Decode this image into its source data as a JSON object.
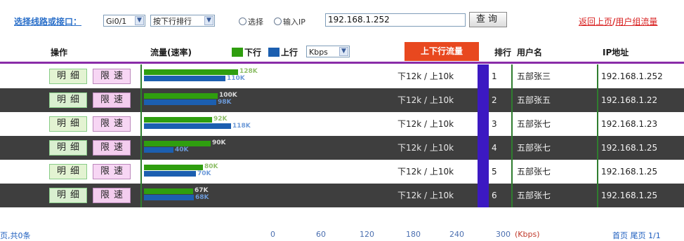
{
  "toolbar": {
    "line_label": "选择线路或接口：",
    "interface_value": "Gi0/1",
    "sort_value": "按下行排行",
    "radio_select_label": "选择",
    "radio_input_label": "输入IP",
    "ip_value": "192.168.1.252",
    "query_label": "查询",
    "back_link": "返回上页",
    "group_link": "用户组流量",
    "link_separator": "/"
  },
  "header": {
    "op_label": "操作",
    "flow_label": "流量(速率)",
    "legend_down_label": "下行",
    "legend_up_label": "上行",
    "unit_value": "Kbps",
    "sort_label": "上下行流量",
    "rank_label": "排行",
    "user_label": "用户名",
    "ip_label": "IP地址"
  },
  "buttons": {
    "detail": "明细",
    "limit": "限速"
  },
  "rows": [
    {
      "up_label": "128K",
      "down_label": "110K",
      "speed": "下12k / 上10k",
      "rank": "1",
      "user": "五部张三",
      "ip": "192.168.1.252"
    },
    {
      "up_label": "100K",
      "down_label": "98K",
      "speed": "下12k / 上10k",
      "rank": "2",
      "user": "五部张五",
      "ip": "192.168.1.22"
    },
    {
      "up_label": "92K",
      "down_label": "118K",
      "speed": "下12k / 上10k",
      "rank": "3",
      "user": "五部张七",
      "ip": "192.168.1.23"
    },
    {
      "up_label": "90K",
      "down_label": "40K",
      "speed": "下12k / 上10k",
      "rank": "4",
      "user": "五部张七",
      "ip": "192.168.1.25"
    },
    {
      "up_label": "80K",
      "down_label": "70K",
      "speed": "下12k / 上10k",
      "rank": "5",
      "user": "五部张七",
      "ip": "192.168.1.25"
    },
    {
      "up_label": "67K",
      "down_label": "68K",
      "speed": "下12k / 上10k",
      "rank": "6",
      "user": "五部张七",
      "ip": "192.168.1.25"
    }
  ],
  "rate_values": [
    {
      "up": 128,
      "down": 110
    },
    {
      "up": 100,
      "down": 98
    },
    {
      "up": 92,
      "down": 118
    },
    {
      "up": 90,
      "down": 40
    },
    {
      "up": 80,
      "down": 70
    },
    {
      "up": 67,
      "down": 68
    }
  ],
  "footer": {
    "count_text": "页,共0条",
    "scale_ticks": [
      "0",
      "60",
      "120",
      "180",
      "240",
      "300"
    ],
    "unit_text": "(Kbps)",
    "first_page": "首页",
    "last_page": "尾页",
    "page_text": "1/1"
  },
  "colors": {
    "up_bar": "#2f9e0f",
    "down_bar": "#1c5fb0",
    "sort_header": "#e8481f",
    "dark_row": "#3e3e3e",
    "link_red": "#d81f1f"
  }
}
